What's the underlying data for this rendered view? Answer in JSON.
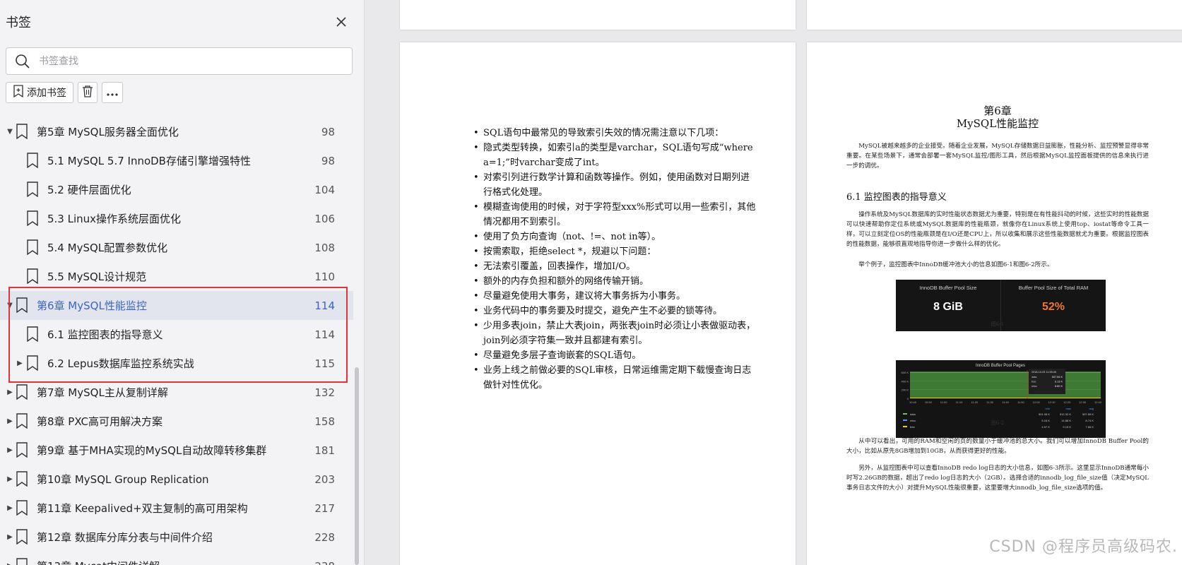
{
  "sidebar": {
    "title": "书签",
    "search_placeholder": "书签查找",
    "add_bookmark_label": "添加书签",
    "items": [
      {
        "title": "第5章   MySQL服务器全面优化",
        "page": "98",
        "level": 0,
        "expanded": true
      },
      {
        "title": "5.1   MySQL 5.7 InnoDB存储引擎增强特性",
        "page": "98",
        "level": 1
      },
      {
        "title": "5.2   硬件层面优化",
        "page": "104",
        "level": 1
      },
      {
        "title": "5.3   Linux操作系统层面优化",
        "page": "106",
        "level": 1
      },
      {
        "title": "5.4   MySQL配置参数优化",
        "page": "108",
        "level": 1
      },
      {
        "title": "5.5   MySQL设计规范",
        "page": "110",
        "level": 1
      },
      {
        "title": "第6章   MySQL性能监控",
        "page": "114",
        "level": 0,
        "expanded": true,
        "active": true
      },
      {
        "title": "6.1   监控图表的指导意义",
        "page": "114",
        "level": 1
      },
      {
        "title": "6.2   Lepus数据库监控系统实战",
        "page": "115",
        "level": 1,
        "collapsed": true
      },
      {
        "title": "第7章   MySQL主从复制详解",
        "page": "132",
        "level": 0,
        "collapsed": true
      },
      {
        "title": "第8章   PXC高可用解决方案",
        "page": "158",
        "level": 0,
        "collapsed": true
      },
      {
        "title": "第9章   基于MHA实现的MySQL自动故障转移集群",
        "page": "181",
        "level": 0,
        "collapsed": true
      },
      {
        "title": "第10章   MySQL Group Replication",
        "page": "203",
        "level": 0,
        "collapsed": true
      },
      {
        "title": "第11章   Keepalived+双主复制的高可用架构",
        "page": "217",
        "level": 0,
        "collapsed": true
      },
      {
        "title": "第12章   数据库分库分表与中间件介绍",
        "page": "228",
        "level": 0,
        "collapsed": true
      },
      {
        "title": "第13章   Mycat中间件详解",
        "page": "238",
        "level": 0,
        "collapsed": true
      }
    ]
  },
  "left_page": {
    "bullets": [
      "SQL语句中最常见的导致索引失效的情况需注意以下几项：",
      "隐式类型转换，如索引a的类型是varchar，SQL语句写成“where a=1;”时varchar变成了int。",
      "对索引列进行数学计算和函数等操作。例如，使用函数对日期列进行格式化处理。",
      "模糊查询使用的时候，对于字符型xxx%形式可以用一些索引，其他情况都用不到索引。",
      "使用了负方向查询（not、!=、not in等）。",
      "按需索取，拒绝select *，规避以下问题：",
      "无法索引覆盖，回表操作，增加I/O。",
      "额外的内存负担和额外的网络传输开销。",
      "尽量避免使用大事务，建议将大事务拆为小事务。",
      "业务代码中的事务要及时提交，避免产生不必要的锁等待。",
      "少用多表join，禁止大表join，两张表join时必须让小表做驱动表，join列必须字符集一致并且都建有索引。",
      "尽量避免多层子查询嵌套的SQL语句。",
      "业务上线之前做必要的SQL审核，日常运维需定期下载慢查询日志做针对性优化。"
    ]
  },
  "right_page": {
    "chapter_num": "第6章",
    "chapter_title": "MySQL性能监控",
    "intro": "MySQL被越来越多的企业接受。随着企业发展，MySQL存储数据日益膨胀，性能分析、监控预警显得非常重要。在某些场景下，通常会部署一套MySQL监控/图形工具，然后根据MySQL监控面板提供的信息来执行进一步的调优。",
    "section": "6.1   监控图表的指导意义",
    "para1": "操作系统及MySQL数据库的实时性能状态数据尤为重要，特别是在有性能抖动的时候，这些实时的性能数据可以快速帮助你定位系统或MySQL数据库的性能瓶颈，就像你在Linux系统上使用top、iostat等命令工具一样，可以立刻定位OS的性能瓶颈是在I/O还是CPU上，所以收集和展示这些性能数据就尤为重要。根据监控图表的性能数据，能够很直观地指导你进一步做什么样的优化。",
    "para2": "举个例子，监控图表中InnoDB缓冲池大小的信息如图6-1和图6-2所示。",
    "fig1": {
      "left_label": "InnoDB Buffer Pool Size",
      "left_value": "8 GiB",
      "right_label": "Buffer Pool Size of Total RAM",
      "right_value": "52%",
      "value_color": "#ffffff",
      "percent_color": "#f1782a",
      "caption": "图6-1"
    },
    "fig2": {
      "title": "InnoDB Buffer Pool Pages",
      "y_ticks": [
        "600 K",
        "400 K",
        "200 K",
        "0"
      ],
      "x_ticks": [
        "10:40",
        "10:50",
        "11:00",
        "11:10",
        "11:20",
        "11:30",
        "11:40",
        "11:50",
        "12:00",
        "12:10",
        "12:20",
        "12:30",
        "12:40"
      ],
      "tooltip_time": "2018-10-03 11:55:45",
      "tooltip_rows": [
        {
          "name": "data",
          "value": "507.55 K"
        },
        {
          "name": "free",
          "value": "6.13 K"
        },
        {
          "name": "misc",
          "value": "8.80 K"
        }
      ],
      "legend_headers": [
        "min",
        "max",
        "avg"
      ],
      "legend_rows": [
        {
          "name": "data",
          "color": "#73bf69",
          "min": "501.96 K",
          "max": "512.32 K",
          "avg": "507.59 K"
        },
        {
          "name": "misc",
          "color": "#5794f2",
          "min": "5.16 K",
          "max": "14.88 K",
          "avg": "8.74 K"
        },
        {
          "name": "free",
          "color": "#f2cc0c",
          "min": "4.97 K",
          "max": "9.19 K",
          "avg": "7.66 K"
        }
      ],
      "caption": "图6-2"
    },
    "para3": "从中可以看出，可用的RAM和空闲的页的数量小于缓冲池的总大小。我们可以增加InnoDB Buffer Pool的大小，比如从原先8GB增加到10GB，从而获得更好的性能。",
    "para4": "另外，从监控图表中可以查看InnoDB redo log日志的大小信息，如图6-3所示。这里显示InnoDB通常每小时写2.26GB的数据，超出了redo log日志的大小（2GB）。选择合适的innodb_log_file_size值（决定MySQL事务日志文件的大小）对提升MySQL性能很重要，这里要增大innodb_log_file_size选项的值。"
  },
  "watermark": "CSDN @程序员高级码农."
}
